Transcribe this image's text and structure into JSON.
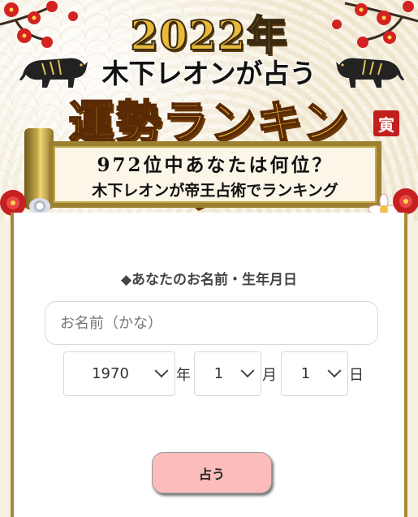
{
  "banner": {
    "year_title": "2022年",
    "subtitle": "木下レオンが占う",
    "main_title": "運勢ランキング",
    "seal": "寅",
    "scroll_line1": "972位中あなたは何位？",
    "scroll_line2": "木下レオンが帝王占術でランキング"
  },
  "form": {
    "label": "◆あなたのお名前・生年月日",
    "name_placeholder": "お名前（かな）",
    "year_value": "1970",
    "year_unit": "年",
    "month_value": "1",
    "month_unit": "月",
    "day_value": "1",
    "day_unit": "日",
    "submit_label": "占う"
  },
  "colors": {
    "gold": "#e8b93a",
    "frame": "#a8893a",
    "button": "#fdbcbc",
    "seal": "#c21e1e",
    "blossom": "#d32222"
  },
  "icons": [
    "tiger-icon",
    "plum-blossom-icon",
    "chevron-down-icon",
    "chrysanthemum-icon"
  ]
}
